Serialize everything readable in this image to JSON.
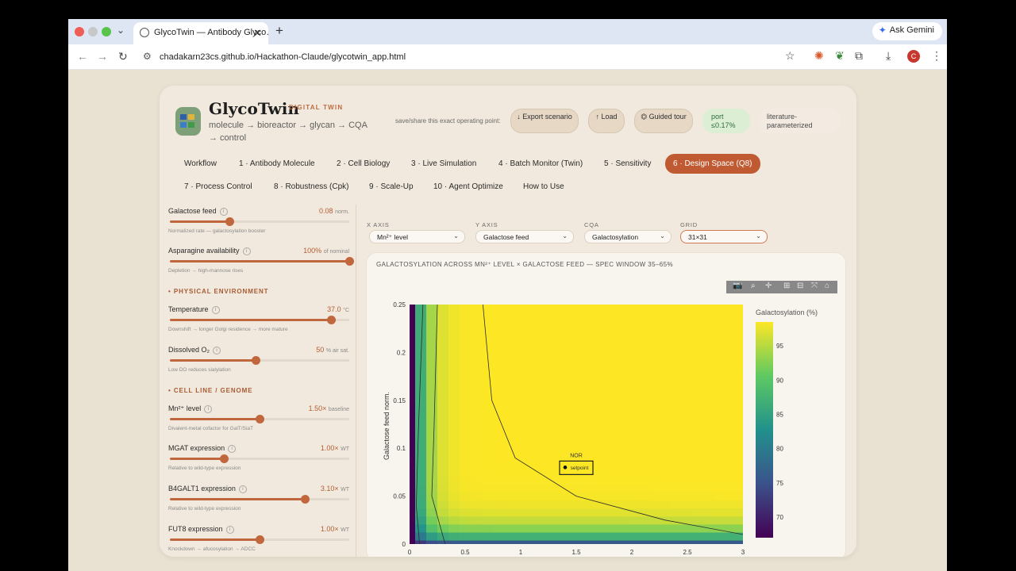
{
  "browser": {
    "tab_title": "GlycoTwin — Antibody Glyco…",
    "url": "chadakarn23cs.github.io/Hackathon-Claude/glycotwin_app.html",
    "gemini_label": "Ask Gemini",
    "profile_initial": "C"
  },
  "header": {
    "brand": "GlycoTwin",
    "tag": "DIGITAL TWIN",
    "subtitle": "molecule → bioreactor → glycan → CQA → control",
    "save_note": "save/share this exact operating point:",
    "export_label": "↓ Export scenario",
    "load_label": "↑ Load",
    "tour_label": "⏣ Guided tour",
    "port_badge": "port ≤0.17%",
    "literature_badge": "literature-parameterized"
  },
  "nav": {
    "row1": [
      "Workflow",
      "1 · Antibody Molecule",
      "2 · Cell Biology",
      "3 · Live Simulation",
      "4 · Batch Monitor (Twin)",
      "5 · Sensitivity",
      "6 · Design Space (Q8)"
    ],
    "row2": [
      "7 · Process Control",
      "8 · Robustness (Cpk)",
      "9 · Scale-Up",
      "10 · Agent Optimize",
      "How to Use"
    ],
    "active": "6 · Design Space (Q8)"
  },
  "params": {
    "galactose": {
      "name": "Galactose feed",
      "value": "0.08",
      "unit": "norm.",
      "help": "Normalized rate — galactosylation booster",
      "level": 0.33
    },
    "asparagine": {
      "name": "Asparagine availability",
      "value": "100%",
      "unit": "of nominal",
      "help": "Depletion → high-mannose rises",
      "level": 1.0
    },
    "temperature": {
      "name": "Temperature",
      "value": "37.0",
      "unit": "°C",
      "help": "Downshift → longer Golgi residence → more mature",
      "level": 0.9
    },
    "dissolved_o2": {
      "name": "Dissolved O₂",
      "value": "50",
      "unit": "% air sat.",
      "help": "Low DO reduces sialylation",
      "level": 0.48
    },
    "mn": {
      "name": "Mn²⁺ level",
      "value": "1.50×",
      "unit": "baseline",
      "help": "Divalent-metal cofactor for GalT/SiaT",
      "level": 0.5
    },
    "mgat": {
      "name": "MGAT expression",
      "value": "1.00×",
      "unit": "WT",
      "help": "Relative to wild-type expression",
      "level": 0.3
    },
    "b4galt1": {
      "name": "B4GALT1 expression",
      "value": "3.10×",
      "unit": "WT",
      "help": "Relative to wild-type expression",
      "level": 0.75
    },
    "fut8": {
      "name": "FUT8 expression",
      "value": "1.00×",
      "unit": "WT",
      "help": "Knockdown → afucosylation → ADCC",
      "level": 0.5
    }
  },
  "sections": {
    "physical": "PHYSICAL ENVIRONMENT",
    "cell_line": "CELL LINE / GENOME"
  },
  "controls": {
    "x_axis_label": "X AXIS",
    "x_axis_value": "Mn²⁺ level",
    "y_axis_label": "Y AXIS",
    "y_axis_value": "Galactose feed",
    "cqa_label": "CQA",
    "cqa_value": "Galactosylation",
    "grid_label": "GRID",
    "grid_value": "31×31"
  },
  "chart_data": {
    "type": "heatmap",
    "title": "GALACTOSYLATION ACROSS MN²⁺ LEVEL × GALACTOSE FEED — SPEC WINDOW 35–65%",
    "xlabel": "",
    "ylabel": "Galactose feed norm.",
    "xlim": [
      0,
      3
    ],
    "ylim": [
      0,
      0.25
    ],
    "x_ticks": [
      "0",
      "0.5",
      "1",
      "1.5",
      "2",
      "2.5",
      "3"
    ],
    "y_ticks": [
      "0",
      "0.05",
      "0.1",
      "0.15",
      "0.2",
      "0.25"
    ],
    "colorbar_title": "Galactosylation (%)",
    "colorbar_ticks": [
      "70",
      "75",
      "80",
      "85",
      "90",
      "95"
    ],
    "zrange": [
      67,
      98.5
    ],
    "colorscale": [
      "#440154",
      "#3b528b",
      "#21918c",
      "#5ec962",
      "#fde725"
    ],
    "annotation_label": "NOR",
    "setpoint_label": "setpoint",
    "setpoint": {
      "x": 1.5,
      "y": 0.08
    }
  }
}
